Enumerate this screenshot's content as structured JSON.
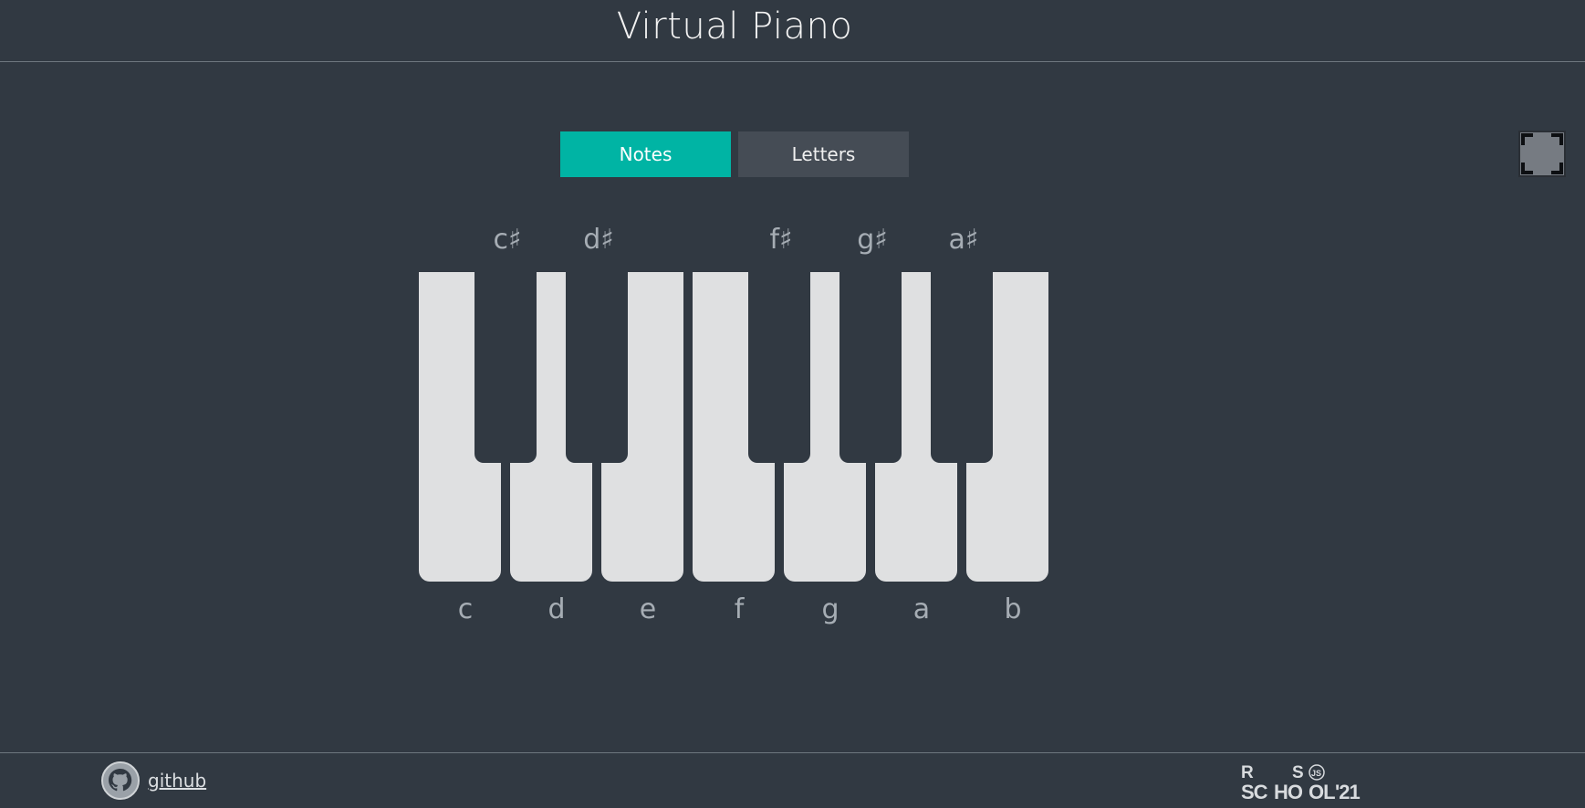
{
  "header": {
    "title": "Virtual Piano"
  },
  "mode_buttons": [
    {
      "label": "Notes",
      "active": true
    },
    {
      "label": "Letters",
      "active": false
    }
  ],
  "keys": {
    "white": [
      "c",
      "d",
      "e",
      "f",
      "g",
      "a",
      "b"
    ],
    "black": [
      "c♯",
      "d♯",
      "f♯",
      "g♯",
      "a♯"
    ]
  },
  "footer": {
    "github_label": "github",
    "logo_text": {
      "r": "R",
      "s": "S",
      "js": "JS",
      "school_a": "SC",
      "school_b": "HO",
      "school_c": "OL",
      "year": "'21"
    }
  },
  "colors": {
    "background": "#313942",
    "accent": "#00b4a4",
    "key_white": "#dfe0e1",
    "label": "#a6adb4"
  }
}
